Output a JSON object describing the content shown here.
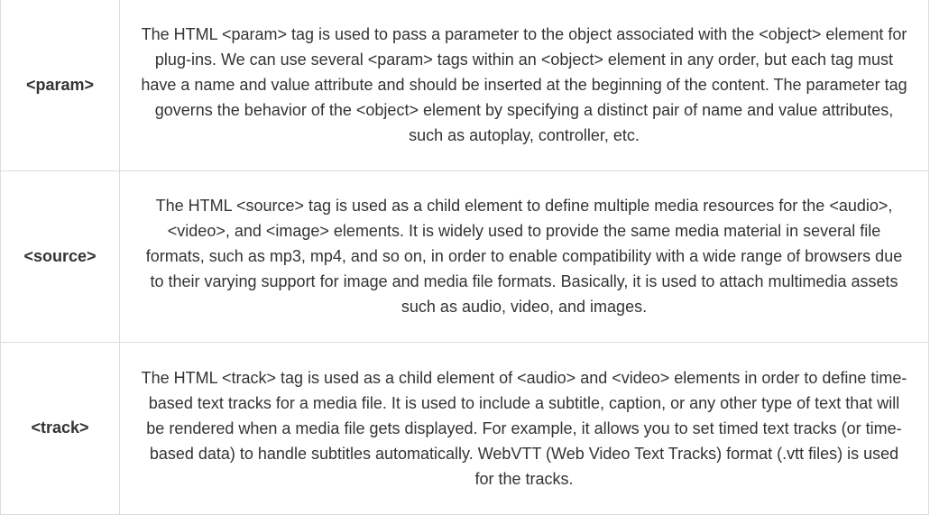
{
  "rows": [
    {
      "tag": "<param>",
      "description": "The HTML <param> tag is used to pass a parameter to the object associated with the <object> element for plug-ins. We can use several <param> tags within an <object> element in any order, but each tag must have a name and value attribute and should be inserted at the beginning of the content. The parameter tag governs the behavior of the <object> element by specifying a distinct pair of name and value attributes, such as autoplay, controller, etc."
    },
    {
      "tag": "<source>",
      "description": "The HTML <source> tag is used as a child element to define multiple media resources for the <audio>, <video>, and <image> elements. It is widely used to provide the same media material in several file formats, such as mp3, mp4, and so on, in order to enable compatibility with a wide range of browsers due to their varying support for image and media file formats. Basically, it is used to attach multimedia assets such as audio, video, and images."
    },
    {
      "tag": "<track>",
      "description": "The HTML <track> tag is used as a child element of <audio> and <video> elements in order to define time-based text tracks for a media file.  It is used to include a subtitle, caption, or any other type of text that will be rendered when a media file gets displayed. For example, it allows you to set timed text tracks (or time-based data) to handle subtitles automatically. WebVTT (Web Video Text Tracks) format (.vtt files) is used for the tracks."
    }
  ],
  "colors": {
    "text": "#333333",
    "border": "#dcdcdc",
    "background": "#ffffff"
  }
}
